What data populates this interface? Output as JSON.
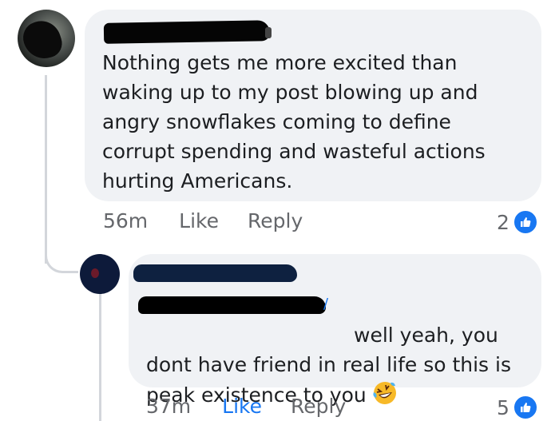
{
  "comment_1": {
    "text": "Nothing gets me more excited than\nwaking up to my post blowing up and\nangry snowflakes coming to define\ncorrupt spending and wasteful actions\nhurting Americans.",
    "time": "56m",
    "like_label": "Like",
    "reply_label": "Reply",
    "reaction_count": "2",
    "reaction_icon": "thumbs-up-icon"
  },
  "comment_2": {
    "text_line1": "well yeah, you",
    "text_rest": "dont have friend in real life so this is\npeak existence to you",
    "emoji": "laughing-tears-emoji",
    "time": "37m",
    "like_label": "Like",
    "reply_label": "Reply",
    "reaction_count": "5",
    "reaction_icon": "thumbs-up-icon",
    "liked": true
  },
  "colors": {
    "bubble": "#f0f2f5",
    "accent": "#1877f2",
    "meta": "#65676b",
    "text": "#1c1e21"
  }
}
